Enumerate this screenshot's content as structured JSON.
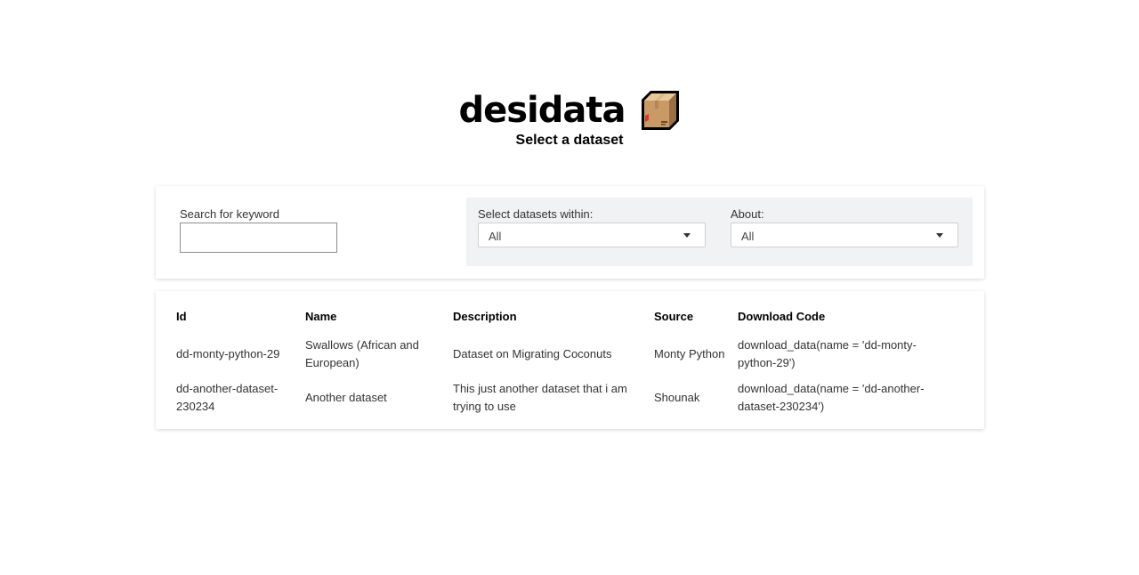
{
  "header": {
    "title": "desidata",
    "logo_icon": "package-box-icon",
    "subtitle": "Select a dataset"
  },
  "filters": {
    "search_label": "Search for keyword",
    "search_value": "",
    "within_label": "Select datasets within:",
    "within_value": "All",
    "about_label": "About:",
    "about_value": "All"
  },
  "table": {
    "columns": [
      "Id",
      "Name",
      "Description",
      "Source",
      "Download Code"
    ],
    "rows": [
      {
        "id": "dd-monty-python-29",
        "name": "Swallows (African and European)",
        "description": "Dataset on Migrating Coconuts",
        "source": "Monty Python",
        "code": "download_data(name = 'dd-monty-python-29')"
      },
      {
        "id": "dd-another-dataset-230234",
        "name": "Another dataset",
        "description": "This just another dataset that i am trying to use",
        "source": "Shounak",
        "code": "download_data(name = 'dd-another-dataset-230234')"
      }
    ]
  },
  "colors": {
    "panel_bg": "#f1f2f4",
    "box_brown": "#c69c6d"
  }
}
